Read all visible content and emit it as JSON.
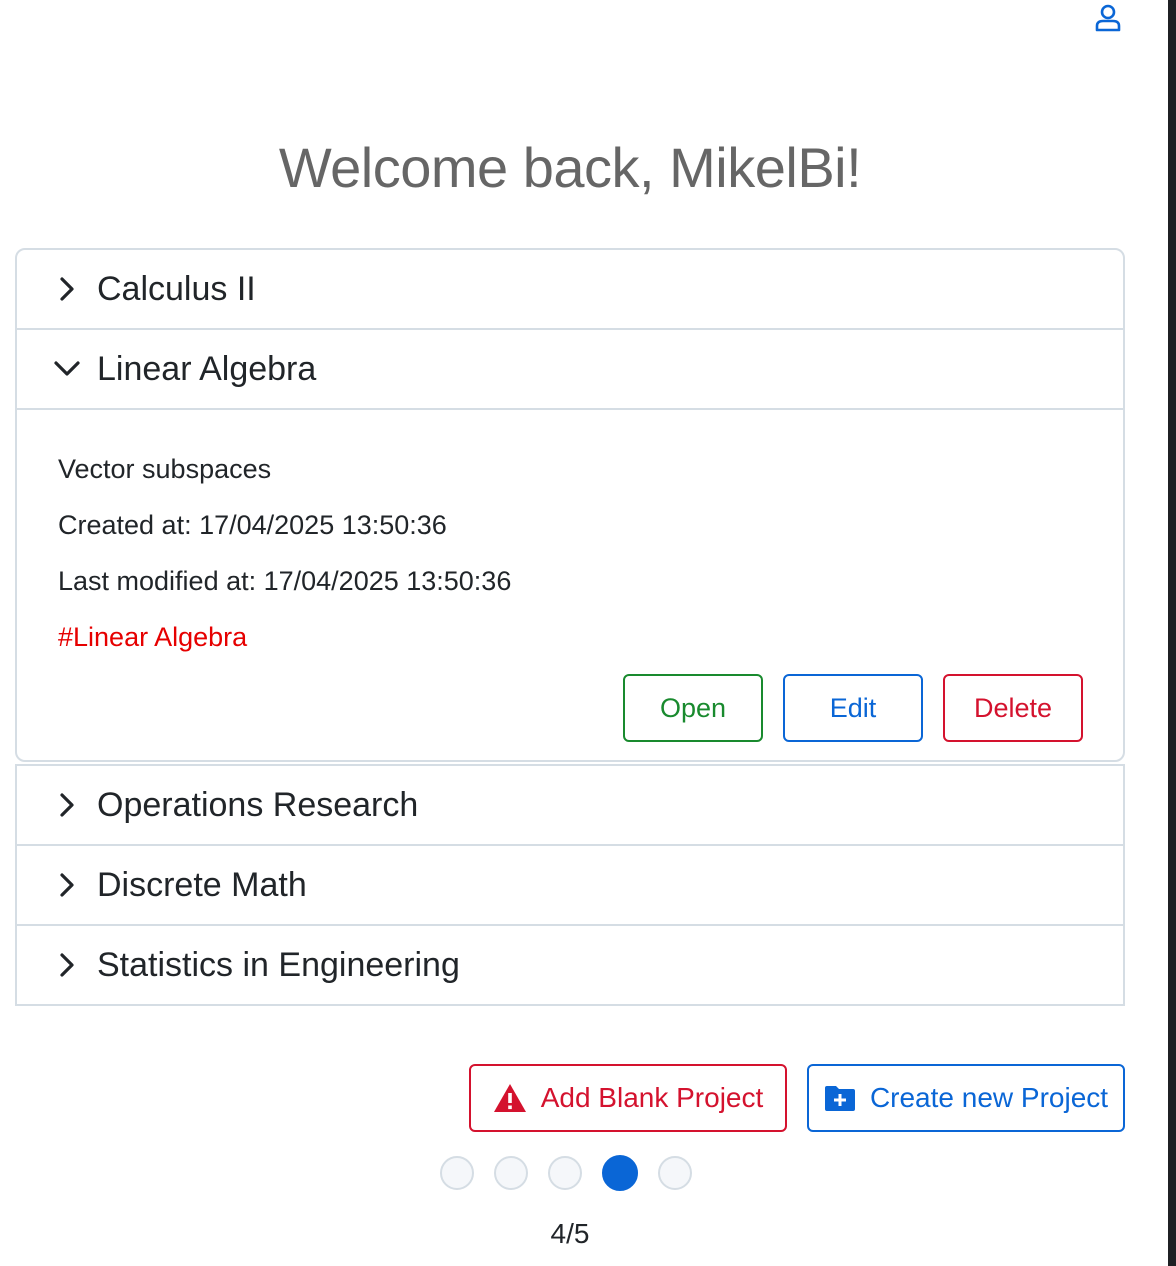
{
  "header": {
    "user_icon": "person-icon",
    "welcome": "Welcome back, MikelBi!"
  },
  "projects": [
    {
      "title": "Calculus II",
      "expanded": false
    },
    {
      "title": "Linear Algebra",
      "expanded": true,
      "description": "Vector subspaces",
      "created": "Created at: 17/04/2025 13:50:36",
      "modified": "Last modified at: 17/04/2025 13:50:36",
      "tag": "#Linear Algebra",
      "actions": {
        "open": "Open",
        "edit": "Edit",
        "delete": "Delete"
      }
    },
    {
      "title": "Operations Research",
      "expanded": false
    },
    {
      "title": "Discrete Math",
      "expanded": false
    },
    {
      "title": "Statistics in Engineering",
      "expanded": false
    }
  ],
  "footer": {
    "add_blank": "Add Blank Project",
    "create_new": "Create new Project",
    "page_indicator": "4/5",
    "current_page": 4,
    "total_pages": 5
  },
  "colors": {
    "primary": "#0a66d6",
    "success": "#198a2e",
    "danger": "#d4122e",
    "tag": "#e60000"
  }
}
